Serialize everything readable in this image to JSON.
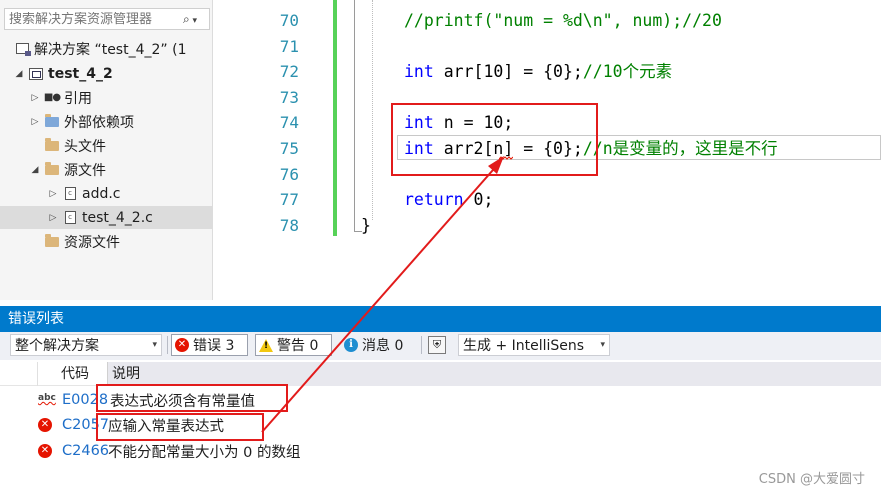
{
  "explorer": {
    "search_placeholder": "搜索解决方案资源管理器",
    "search_icon": "search-icon",
    "items": [
      {
        "label": "解决方案 “test_4_2” (1",
        "icon": "solution-icon"
      },
      {
        "label": "test_4_2",
        "icon": "project-icon"
      },
      {
        "label": "引用",
        "icon": "references-icon"
      },
      {
        "label": "外部依赖项",
        "icon": "external-deps-icon"
      },
      {
        "label": "头文件",
        "icon": "folder-icon"
      },
      {
        "label": "源文件",
        "icon": "folder-icon"
      },
      {
        "label": "add.c",
        "icon": "c-file-icon"
      },
      {
        "label": "test_4_2.c",
        "icon": "c-file-icon"
      },
      {
        "label": "资源文件",
        "icon": "folder-icon"
      }
    ]
  },
  "editor": {
    "lines": [
      {
        "num": "70",
        "parts": [
          {
            "t": "//printf(\"num = %d\\n\", num);//20",
            "c": "cm"
          }
        ]
      },
      {
        "num": "71",
        "parts": []
      },
      {
        "num": "72",
        "parts": [
          {
            "t": "int",
            "c": "kw"
          },
          {
            "t": " arr[10] = {0};",
            "c": "pl"
          },
          {
            "t": "//10个元素",
            "c": "cm"
          }
        ]
      },
      {
        "num": "73",
        "parts": []
      },
      {
        "num": "74",
        "parts": [
          {
            "t": "int",
            "c": "kw"
          },
          {
            "t": " n = 10;",
            "c": "pl"
          }
        ]
      },
      {
        "num": "75",
        "parts": [
          {
            "t": "int",
            "c": "kw"
          },
          {
            "t": " arr2[n] = {0};",
            "c": "pl"
          },
          {
            "t": "//n是变量的，这里是不行",
            "c": "cm"
          }
        ]
      },
      {
        "num": "76",
        "parts": []
      },
      {
        "num": "77",
        "parts": [
          {
            "t": "return",
            "c": "kw"
          },
          {
            "t": " 0;",
            "c": "pl"
          }
        ]
      },
      {
        "num": "78",
        "parts": [
          {
            "t": "}",
            "c": "pl"
          }
        ]
      }
    ],
    "colors": {
      "keyword": "#0000ff",
      "comment": "#008000",
      "line_number": "#2b91af",
      "change_bar": "#57d258"
    }
  },
  "error_list": {
    "title": "错误列表",
    "scope": "整个解决方案",
    "errors_label": "错误 3",
    "warnings_label": "警告 0",
    "messages_label": "消息 0",
    "build_filter": "生成 + IntelliSens",
    "col_code": "代码",
    "col_desc": "说明",
    "rows": [
      {
        "code": "E0028",
        "desc": "表达式必须含有常量值",
        "icon": "intellisense-error-icon"
      },
      {
        "code": "C2057",
        "desc": "应输入常量表达式",
        "icon": "error-icon"
      },
      {
        "code": "C2466",
        "desc": "不能分配常量大小为 0 的数组",
        "icon": "error-icon"
      }
    ],
    "accent": "#007acc"
  },
  "annotation": {
    "color": "#e21b1b"
  },
  "watermark": "CSDN @大爱圆寸"
}
